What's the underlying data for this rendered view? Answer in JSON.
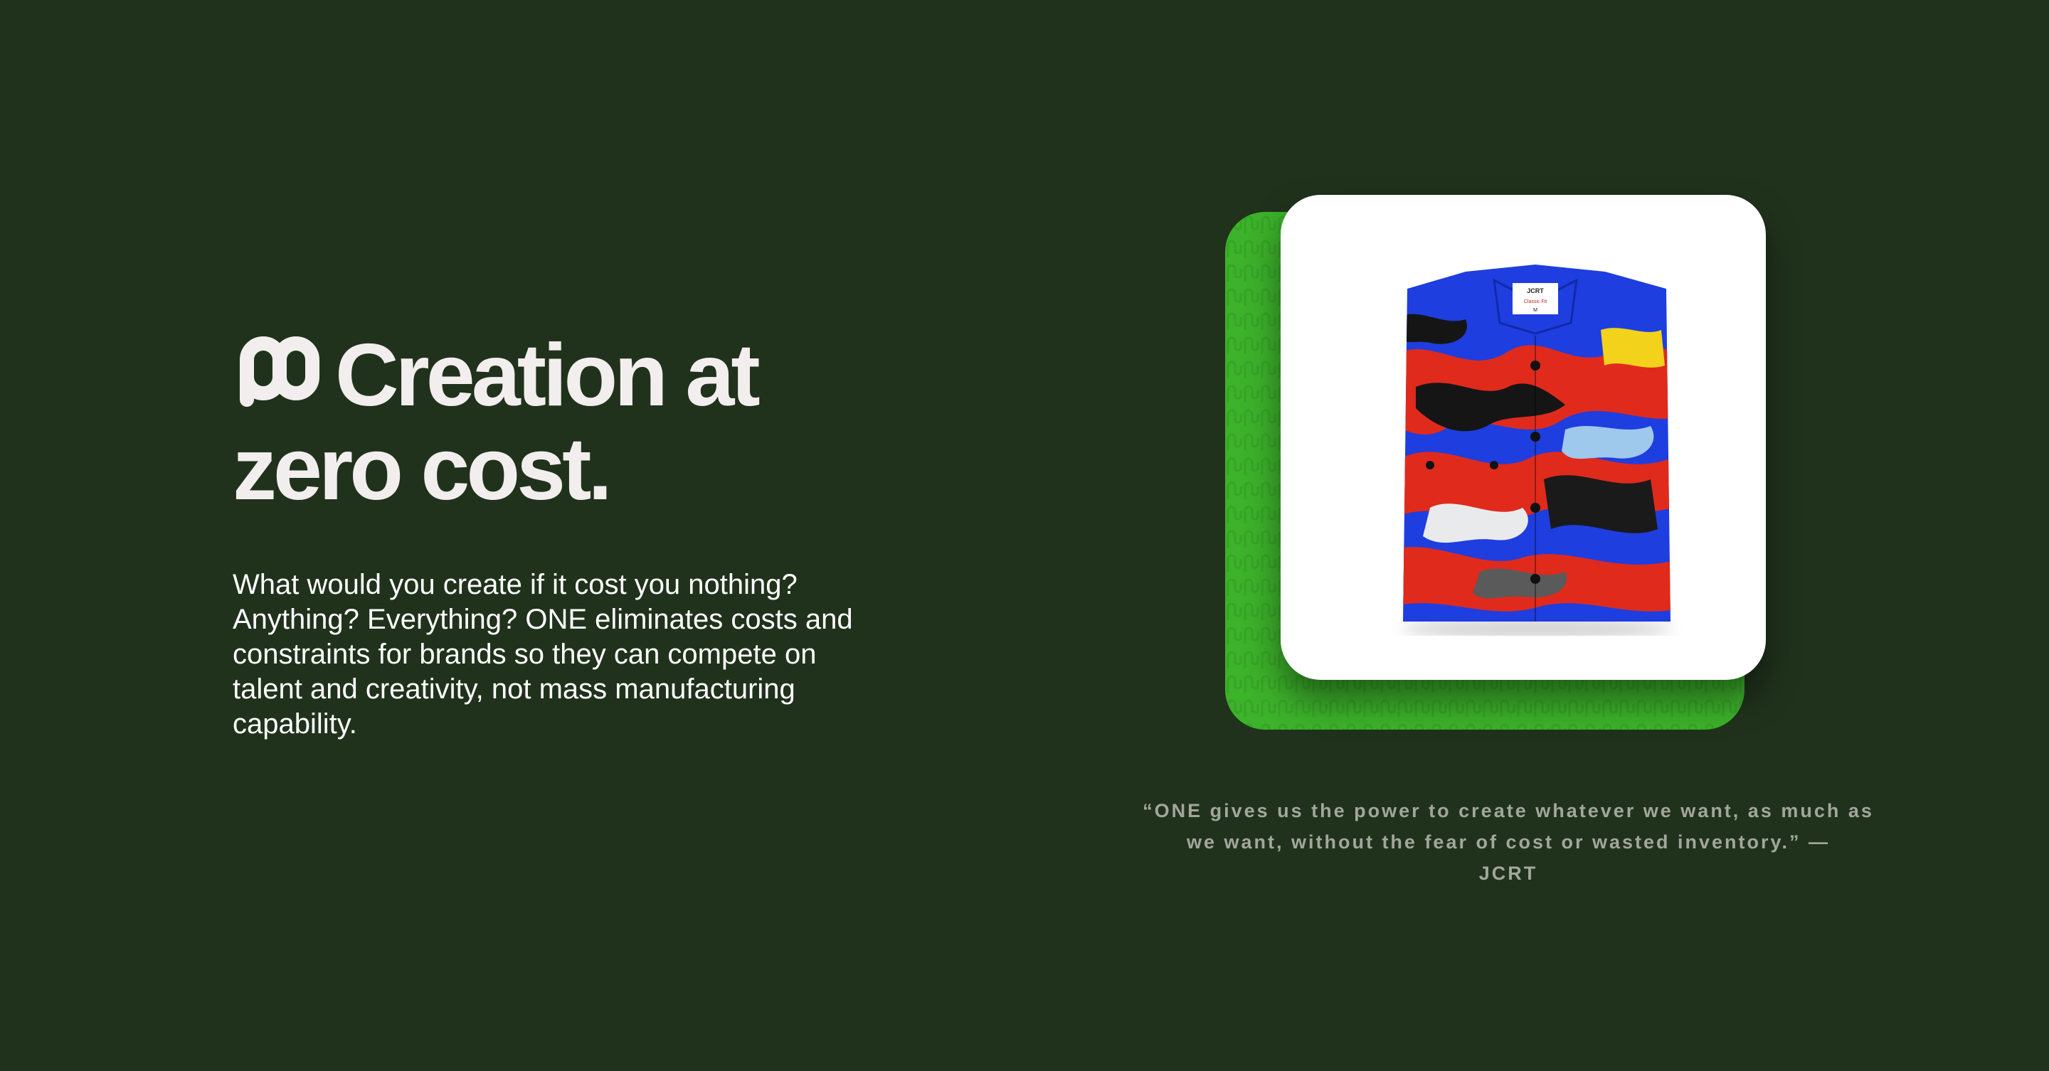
{
  "hero": {
    "title_line1": "Creation at",
    "title_line2": "zero cost.",
    "body": "What would you create if it cost you nothing? Anything? Everything? ONE eliminates costs and constraints for brands so they can compete on talent and creativity, not mass manufacturing capability."
  },
  "testimonial": {
    "quote": "“ONE gives us the power to create whatever we want, as much as we want, without the fear of cost or wasted inventory.” —",
    "attribution": "JCRT"
  },
  "product": {
    "label_brand": "JCRT",
    "label_fit": "Classic Fit",
    "label_size": "M"
  },
  "colors": {
    "background": "#20321c",
    "accent_green": "#3db22b",
    "headline": "#f3eeee",
    "quote_text": "#a3a69d"
  },
  "icons": {
    "logo": "one-logo-icon"
  }
}
